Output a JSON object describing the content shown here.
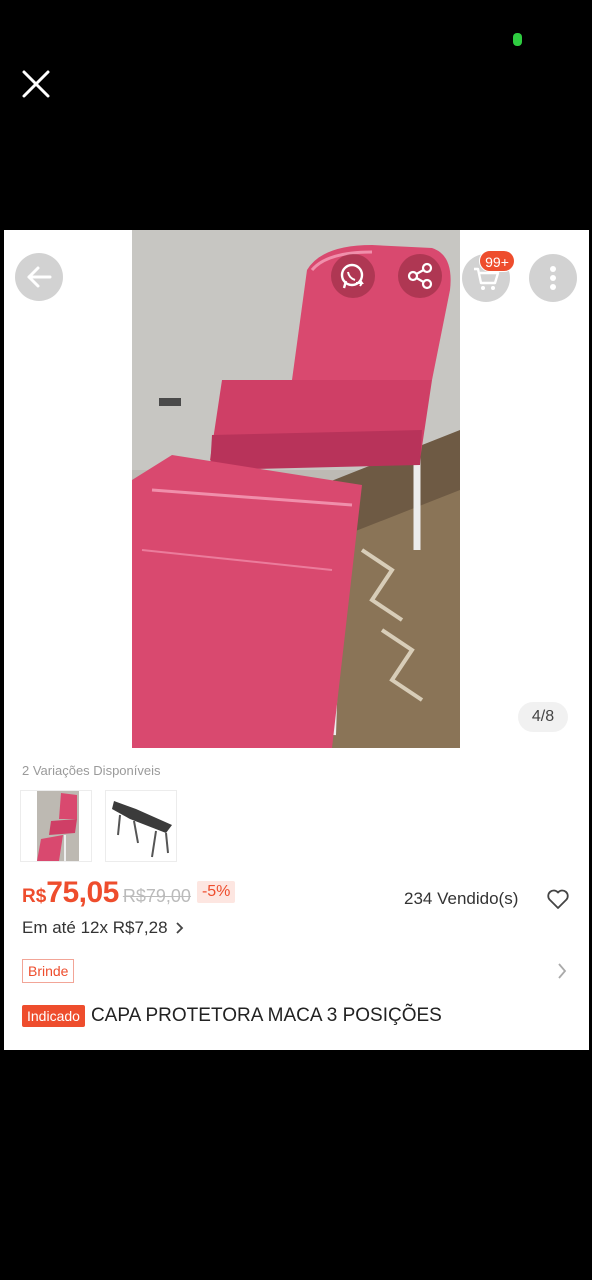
{
  "overlay": {
    "close_icon": "close-icon",
    "status_color": "#2ecc40"
  },
  "gallery": {
    "counter": "4/8",
    "badge": "99+",
    "icons": [
      "back-arrow-icon",
      "whatsapp-icon",
      "share-icon",
      "cart-icon",
      "more-vertical-icon"
    ]
  },
  "variations": {
    "label": "2 Variações Disponíveis",
    "options": [
      {
        "name": "pink",
        "color": "#d9496f"
      },
      {
        "name": "black",
        "color": "#3b3b3b"
      }
    ]
  },
  "price": {
    "currency": "R$",
    "value": "75,05",
    "old": "R$79,00",
    "discount": "-5%",
    "sold": "234 Vendido(s)",
    "installments": "Em até 12x R$7,28"
  },
  "promo": {
    "brinde": "Brinde"
  },
  "product": {
    "badge": "Indicado",
    "title": "CAPA PROTETORA MACA 3 POSIÇÕES"
  },
  "colors": {
    "accent": "#ee4d2d",
    "upholstery": "#d9496f"
  }
}
